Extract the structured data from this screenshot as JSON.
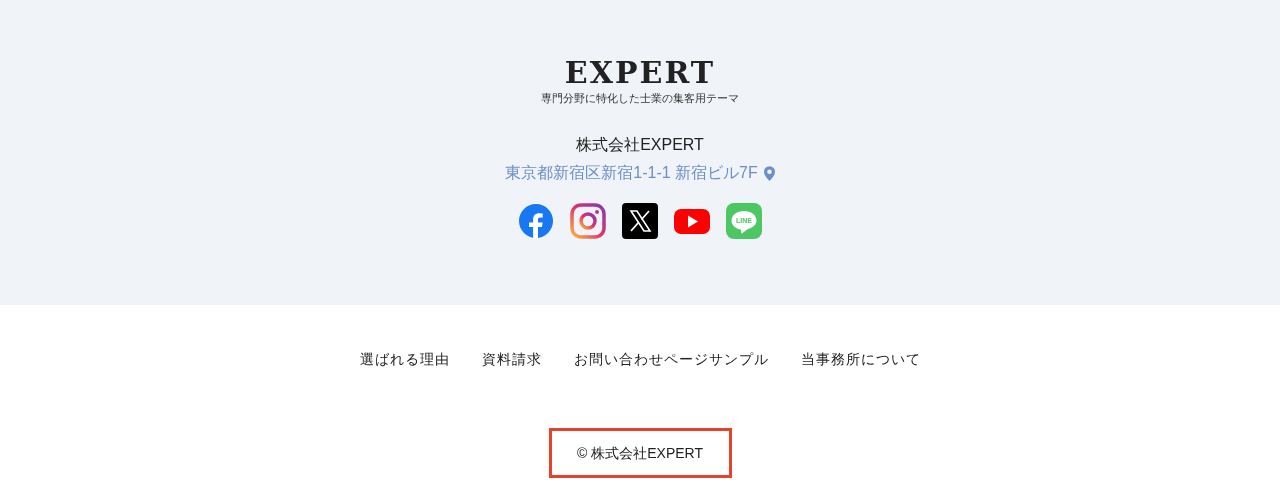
{
  "brand": {
    "logo": "EXPERT",
    "tagline": "専門分野に特化した士業の集客用テーマ"
  },
  "company": "株式会社EXPERT",
  "address": "東京都新宿区新宿1-1-1 新宿ビル7F",
  "social": [
    {
      "kind": "facebook"
    },
    {
      "kind": "instagram"
    },
    {
      "kind": "x"
    },
    {
      "kind": "youtube"
    },
    {
      "kind": "line",
      "label": "LINE"
    }
  ],
  "nav": [
    "選ばれる理由",
    "資料請求",
    "お問い合わせページサンプル",
    "当事務所について"
  ],
  "copyright": {
    "text": "© 株式会社EXPERT",
    "highlighted": true
  }
}
